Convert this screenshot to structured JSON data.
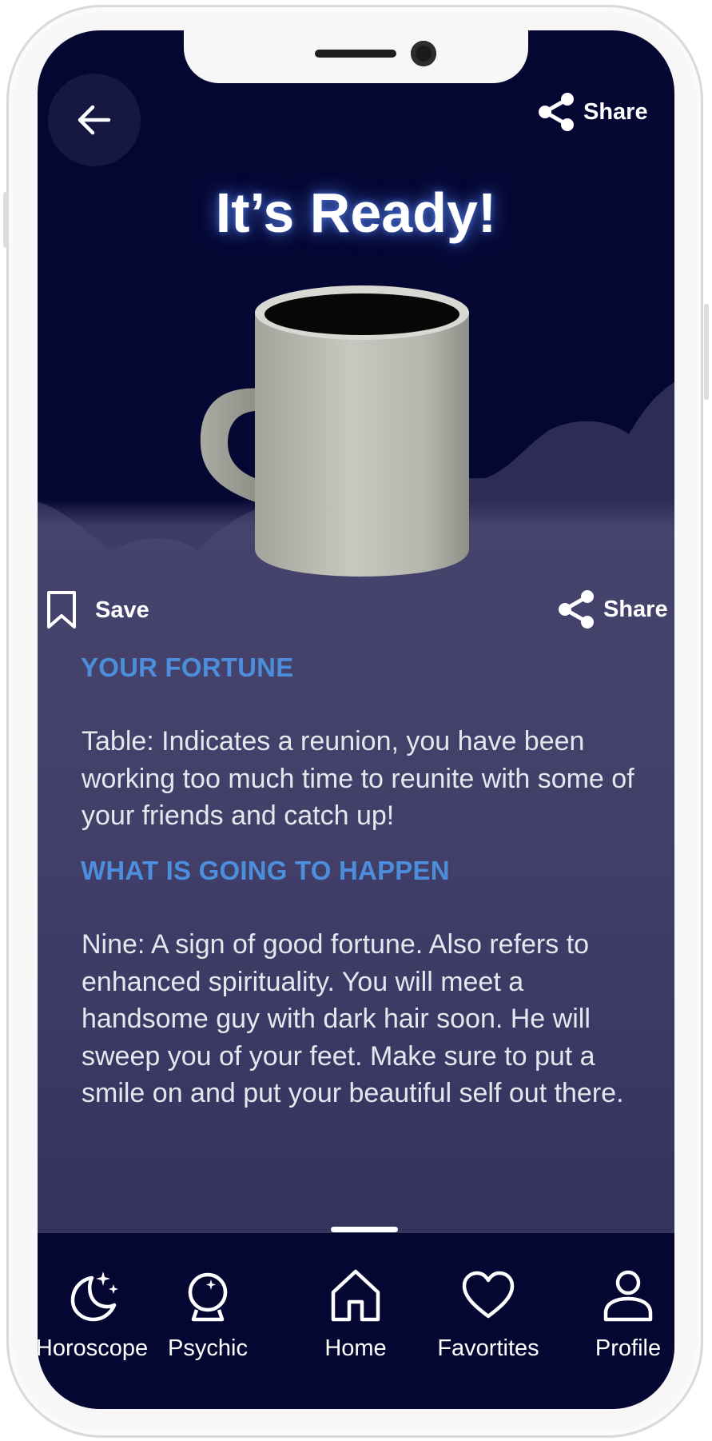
{
  "header": {
    "share_label": "Share",
    "title": "It’s Ready!"
  },
  "actions": {
    "save_label": "Save",
    "share_label": "Share"
  },
  "fortune": {
    "heading": "YOUR FORTUNE",
    "text": "Table: Indicates a reunion, you have been working too much time to reunite with some of your friends and catch up!"
  },
  "happen": {
    "heading": "WHAT IS GOING TO HAPPEN",
    "text": "Nine: A sign of good fortune. Also refers to enhanced spirituality. You will meet a handsome guy with dark hair soon. He will sweep you of your feet. Make sure to put a smile on and put your beautiful self out there."
  },
  "tabs": [
    {
      "label": "Horoscope",
      "icon": "moon-stars-icon"
    },
    {
      "label": "Psychic",
      "icon": "crystal-ball-icon"
    },
    {
      "label": "Home",
      "icon": "home-icon"
    },
    {
      "label": "Favortites",
      "icon": "heart-icon"
    },
    {
      "label": "Profile",
      "icon": "user-icon"
    }
  ],
  "colors": {
    "background_top": "#050733",
    "cloud": "#4a4870",
    "heading_accent": "#4c8edc",
    "text": "#e6e6ee"
  }
}
